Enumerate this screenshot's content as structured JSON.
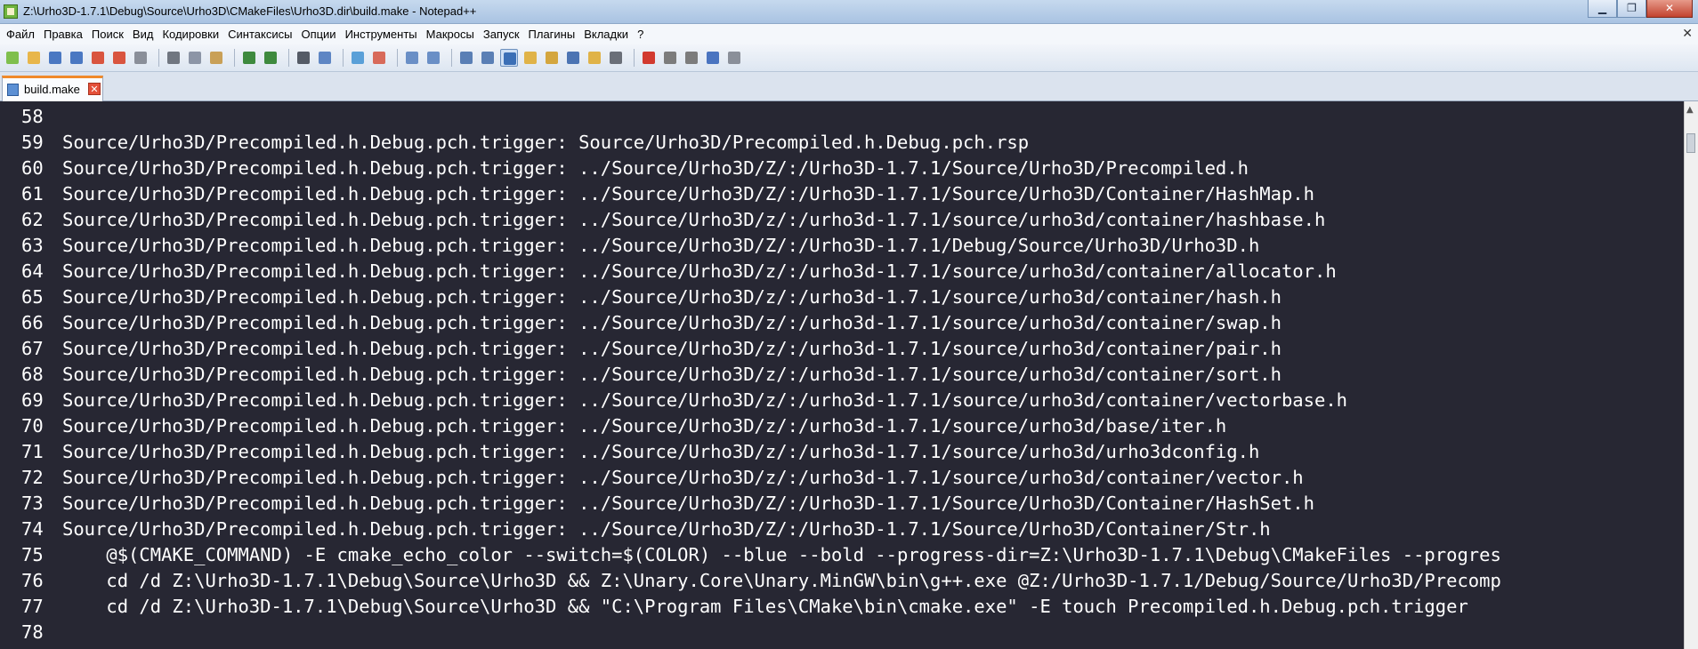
{
  "window": {
    "title": "Z:\\Urho3D-1.7.1\\Debug\\Source\\Urho3D\\CMakeFiles\\Urho3D.dir\\build.make - Notepad++",
    "minimize_glyph": "▁",
    "maximize_glyph": "❐",
    "close_glyph": "✕"
  },
  "menu": {
    "items": [
      "Файл",
      "Правка",
      "Поиск",
      "Вид",
      "Кодировки",
      "Синтаксисы",
      "Опции",
      "Инструменты",
      "Макросы",
      "Запуск",
      "Плагины",
      "Вкладки",
      "?"
    ],
    "close_glyph": "✕"
  },
  "toolbar": {
    "icons": [
      {
        "name": "new-file-icon",
        "color": "#7fbf4d"
      },
      {
        "name": "open-file-icon",
        "color": "#e8b64a"
      },
      {
        "name": "save-icon",
        "color": "#4a78c2"
      },
      {
        "name": "save-all-icon",
        "color": "#4a78c2"
      },
      {
        "name": "close-icon",
        "color": "#d9553f"
      },
      {
        "name": "close-all-icon",
        "color": "#d9553f"
      },
      {
        "name": "print-icon",
        "color": "#8a8f99"
      },
      {
        "name": "sep"
      },
      {
        "name": "cut-icon",
        "color": "#707680"
      },
      {
        "name": "copy-icon",
        "color": "#8c95a6"
      },
      {
        "name": "paste-icon",
        "color": "#c9a057"
      },
      {
        "name": "sep"
      },
      {
        "name": "undo-icon",
        "color": "#3e8a3e"
      },
      {
        "name": "redo-icon",
        "color": "#3e8a3e"
      },
      {
        "name": "sep"
      },
      {
        "name": "find-icon",
        "color": "#555b66"
      },
      {
        "name": "replace-icon",
        "color": "#5e86c4"
      },
      {
        "name": "sep"
      },
      {
        "name": "zoom-in-icon",
        "color": "#5aa0d8"
      },
      {
        "name": "zoom-out-icon",
        "color": "#d86a5a"
      },
      {
        "name": "sep"
      },
      {
        "name": "sync-vertical-icon",
        "color": "#6a8fc6"
      },
      {
        "name": "sync-horizontal-icon",
        "color": "#6a8fc6"
      },
      {
        "name": "sep"
      },
      {
        "name": "word-wrap-icon",
        "color": "#5a7fb5"
      },
      {
        "name": "show-all-chars-icon",
        "color": "#5a7fb5"
      },
      {
        "name": "indent-guide-icon",
        "color": "#3b6fb6",
        "pressed": true
      },
      {
        "name": "user-language-icon",
        "color": "#e0b348"
      },
      {
        "name": "doc-map-icon",
        "color": "#d4a63e"
      },
      {
        "name": "function-list-icon",
        "color": "#4c74b3"
      },
      {
        "name": "folder-workspace-icon",
        "color": "#e0b348"
      },
      {
        "name": "monitoring-icon",
        "color": "#6a6f78"
      },
      {
        "name": "sep"
      },
      {
        "name": "record-macro-icon",
        "color": "#d23a2f"
      },
      {
        "name": "stop-macro-icon",
        "color": "#7c7c7c"
      },
      {
        "name": "play-macro-icon",
        "color": "#7c7c7c"
      },
      {
        "name": "run-macro-multiple-icon",
        "color": "#4a74c0"
      },
      {
        "name": "save-macro-icon",
        "color": "#8a8f99"
      }
    ]
  },
  "tabs": [
    {
      "label": "build.make",
      "close_glyph": "✕"
    }
  ],
  "editor": {
    "lines": [
      {
        "num": "58",
        "text": ""
      },
      {
        "num": "59",
        "text": "Source/Urho3D/Precompiled.h.Debug.pch.trigger: Source/Urho3D/Precompiled.h.Debug.pch.rsp"
      },
      {
        "num": "60",
        "text": "Source/Urho3D/Precompiled.h.Debug.pch.trigger: ../Source/Urho3D/Z/:/Urho3D-1.7.1/Source/Urho3D/Precompiled.h"
      },
      {
        "num": "61",
        "text": "Source/Urho3D/Precompiled.h.Debug.pch.trigger: ../Source/Urho3D/Z/:/Urho3D-1.7.1/Source/Urho3D/Container/HashMap.h"
      },
      {
        "num": "62",
        "text": "Source/Urho3D/Precompiled.h.Debug.pch.trigger: ../Source/Urho3D/z/:/urho3d-1.7.1/source/urho3d/container/hashbase.h"
      },
      {
        "num": "63",
        "text": "Source/Urho3D/Precompiled.h.Debug.pch.trigger: ../Source/Urho3D/Z/:/Urho3D-1.7.1/Debug/Source/Urho3D/Urho3D.h"
      },
      {
        "num": "64",
        "text": "Source/Urho3D/Precompiled.h.Debug.pch.trigger: ../Source/Urho3D/z/:/urho3d-1.7.1/source/urho3d/container/allocator.h"
      },
      {
        "num": "65",
        "text": "Source/Urho3D/Precompiled.h.Debug.pch.trigger: ../Source/Urho3D/z/:/urho3d-1.7.1/source/urho3d/container/hash.h"
      },
      {
        "num": "66",
        "text": "Source/Urho3D/Precompiled.h.Debug.pch.trigger: ../Source/Urho3D/z/:/urho3d-1.7.1/source/urho3d/container/swap.h"
      },
      {
        "num": "67",
        "text": "Source/Urho3D/Precompiled.h.Debug.pch.trigger: ../Source/Urho3D/z/:/urho3d-1.7.1/source/urho3d/container/pair.h"
      },
      {
        "num": "68",
        "text": "Source/Urho3D/Precompiled.h.Debug.pch.trigger: ../Source/Urho3D/z/:/urho3d-1.7.1/source/urho3d/container/sort.h"
      },
      {
        "num": "69",
        "text": "Source/Urho3D/Precompiled.h.Debug.pch.trigger: ../Source/Urho3D/z/:/urho3d-1.7.1/source/urho3d/container/vectorbase.h"
      },
      {
        "num": "70",
        "text": "Source/Urho3D/Precompiled.h.Debug.pch.trigger: ../Source/Urho3D/z/:/urho3d-1.7.1/source/urho3d/base/iter.h"
      },
      {
        "num": "71",
        "text": "Source/Urho3D/Precompiled.h.Debug.pch.trigger: ../Source/Urho3D/z/:/urho3d-1.7.1/source/urho3d/urho3dconfig.h"
      },
      {
        "num": "72",
        "text": "Source/Urho3D/Precompiled.h.Debug.pch.trigger: ../Source/Urho3D/z/:/urho3d-1.7.1/source/urho3d/container/vector.h"
      },
      {
        "num": "73",
        "text": "Source/Urho3D/Precompiled.h.Debug.pch.trigger: ../Source/Urho3D/Z/:/Urho3D-1.7.1/Source/Urho3D/Container/HashSet.h"
      },
      {
        "num": "74",
        "text": "Source/Urho3D/Precompiled.h.Debug.pch.trigger: ../Source/Urho3D/Z/:/Urho3D-1.7.1/Source/Urho3D/Container/Str.h"
      },
      {
        "num": "75",
        "text": "    @$(CMAKE_COMMAND) -E cmake_echo_color --switch=$(COLOR) --blue --bold --progress-dir=Z:\\Urho3D-1.7.1\\Debug\\CMakeFiles --progres"
      },
      {
        "num": "76",
        "text": "    cd /d Z:\\Urho3D-1.7.1\\Debug\\Source\\Urho3D && Z:\\Unary.Core\\Unary.MinGW\\bin\\g++.exe @Z:/Urho3D-1.7.1/Debug/Source/Urho3D/Precomp"
      },
      {
        "num": "77",
        "text": "    cd /d Z:\\Urho3D-1.7.1\\Debug\\Source\\Urho3D && \"C:\\Program Files\\CMake\\bin\\cmake.exe\" -E touch Precompiled.h.Debug.pch.trigger"
      },
      {
        "num": "78",
        "text": ""
      }
    ]
  },
  "scrollbar": {
    "up_glyph": "▲"
  }
}
